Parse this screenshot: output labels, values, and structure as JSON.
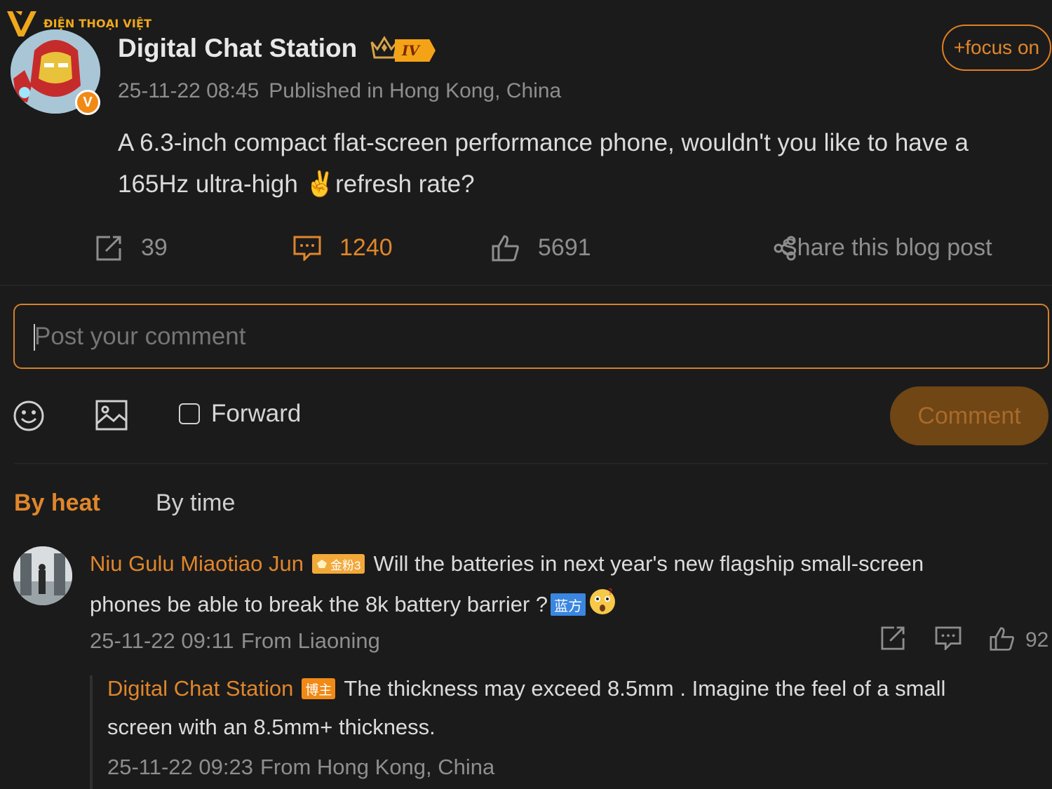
{
  "watermark": {
    "text": "ĐIỆN THOẠI VIỆT"
  },
  "post": {
    "author": "Digital Chat Station",
    "level": "IV",
    "verified_badge": "V",
    "follow_label": "+focus on",
    "timestamp": "25-11-22 08:45",
    "location": "Published in Hong Kong, China",
    "text_line1": "A 6.3-inch compact flat-screen performance phone, wouldn't you like to have a",
    "text_line2_a": "165Hz ultra-high",
    "text_line2_b": "refresh rate?",
    "emoji": "✌️"
  },
  "stats": {
    "reposts": "39",
    "comments": "1240",
    "likes": "5691",
    "share_label": "Share this blog post"
  },
  "composer": {
    "placeholder": "Post your comment",
    "forward_label": "Forward",
    "comment_button": "Comment"
  },
  "sort_tabs": {
    "by_heat": "By heat",
    "by_time": "By time"
  },
  "comments": [
    {
      "user": "Niu Gulu Miaotiao Jun",
      "fan_badge": "金粉3",
      "text_line1": "Will the batteries in next year's new flagship small-screen",
      "text_line2": "phones be able to break the 8k battery barrier ?",
      "team_badge": "蓝方",
      "emoji": "😲",
      "timestamp": "25-11-22 09:11",
      "location": "From Liaoning",
      "likes": "92",
      "reply": {
        "user": "Digital Chat Station",
        "badge": "博主",
        "text_line1": "The thickness may exceed 8.5mm . Imagine the feel of a small",
        "text_line2": "screen with an 8.5mm+ thickness.",
        "timestamp": "25-11-22 09:23",
        "location": "From Hong Kong, China"
      }
    }
  ],
  "colors": {
    "background": "#1b1b1b",
    "accent": "#e0862b",
    "muted_text": "#8e8e8e",
    "comment_button_bg": "#6f4614"
  }
}
